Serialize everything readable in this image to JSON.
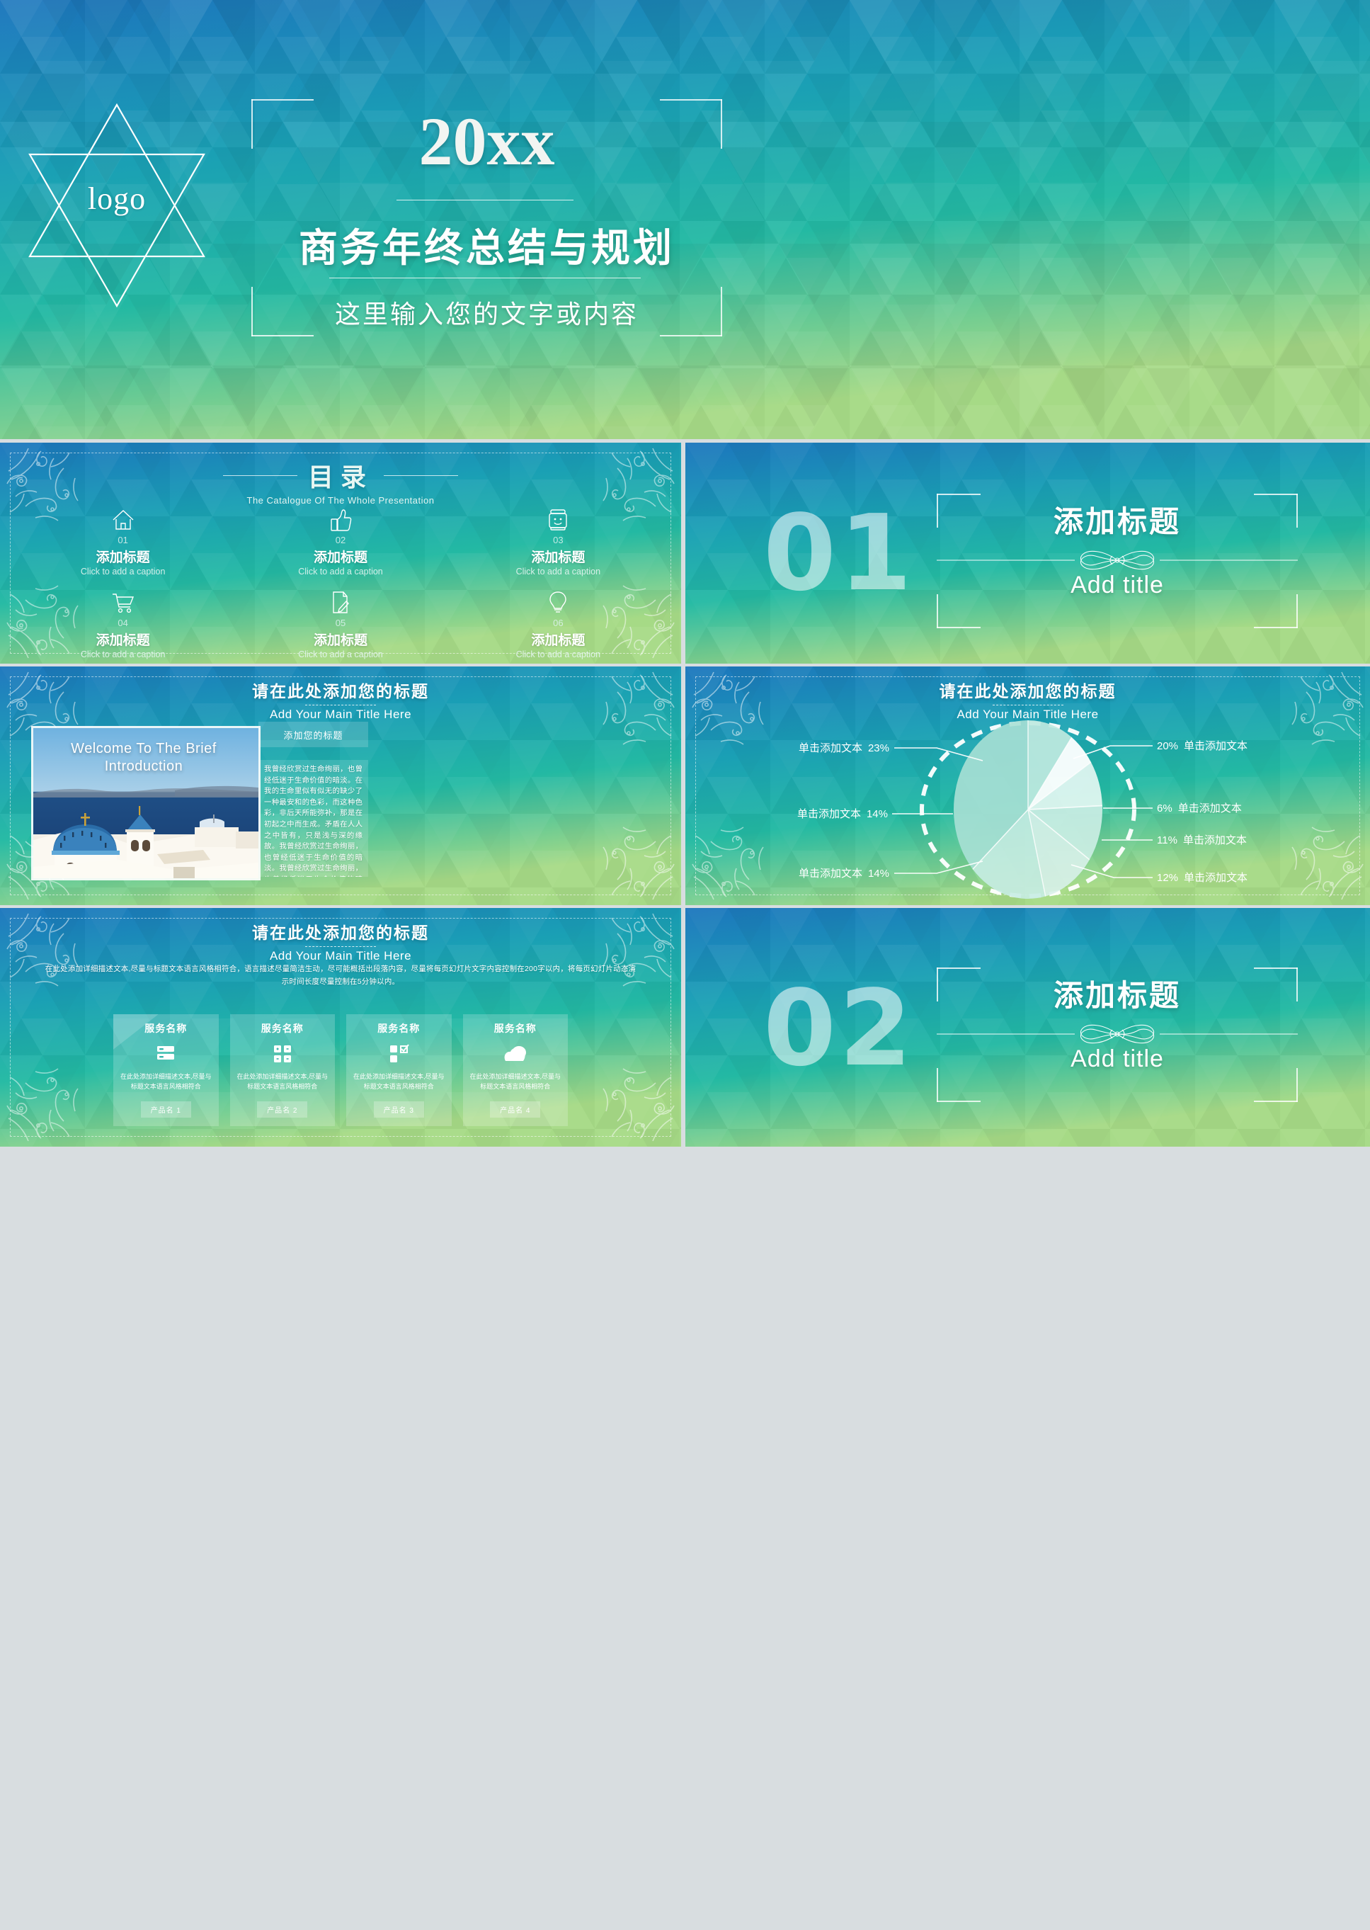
{
  "cover": {
    "logo_text": "logo",
    "year": "20xx",
    "title": "商务年终总结与规划",
    "subtitle": "这里输入您的文字或内容"
  },
  "catalogue": {
    "title": "目录",
    "subtitle": "The Catalogue Of The Whole Presentation",
    "items": [
      {
        "num": "01",
        "icon": "home-icon",
        "title": "添加标题",
        "caption": "Click to add a caption"
      },
      {
        "num": "02",
        "icon": "thumbs-up-icon",
        "title": "添加标题",
        "caption": "Click to add a caption"
      },
      {
        "num": "03",
        "icon": "robot-face-icon",
        "title": "添加标题",
        "caption": "Click to add a caption"
      },
      {
        "num": "04",
        "icon": "cart-icon",
        "title": "添加标题",
        "caption": "Click to add a caption"
      },
      {
        "num": "05",
        "icon": "document-edit-icon",
        "title": "添加标题",
        "caption": "Click to add a caption"
      },
      {
        "num": "06",
        "icon": "lightbulb-icon",
        "title": "添加标题",
        "caption": "Click to add a caption"
      }
    ]
  },
  "section1": {
    "number": "01",
    "title": "添加标题",
    "english": "Add title"
  },
  "section2": {
    "number": "02",
    "title": "添加标题",
    "english": "Add title"
  },
  "welcome": {
    "heading_cn": "请在此处添加您的标题",
    "heading_en": "Add Your Main Title Here",
    "image_caption": "Welcome To The Brief Introduction",
    "panel_label": "添加您的标题",
    "body": "我曾经欣赏过生命绚丽，也曾经低迷于生命价值的暗淡。在我的生命里似有似无的缺少了一种最安和的色彩，而这种色彩，非后天所能弥补，那是在初起之中而生成。矛盾在人人之中皆有，只是浅与深的缘故。我曾经欣赏过生命绚丽，也曾经低迷于生命价值的暗淡。我曾经欣赏过生命绚丽，也曾经低迷于生命价值的暗淡。在我的生命里似有似无的缺少了一种最安和的色彩，而这种色彩，非后天所能弥补，那是在初起之中而生成。"
  },
  "pie_slide": {
    "heading_cn": "请在此处添加您的标题",
    "heading_en": "Add Your Main Title Here"
  },
  "chart_data": {
    "type": "pie",
    "title": "请在此处添加您的标题",
    "subtitle": "Add Your Main Title Here",
    "legend_position": "left-and-right callouts",
    "labels": [
      "单击添加文本",
      "单击添加文本",
      "单击添加文本",
      "单击添加文本",
      "单击添加文本",
      "单击添加文本",
      "单击添加文本"
    ],
    "values": [
      20,
      6,
      11,
      12,
      14,
      14,
      23
    ],
    "value_strings": [
      "20%",
      "6%",
      "11%",
      "12%",
      "14%",
      "14%",
      "23%"
    ],
    "callouts_right": [
      {
        "value": "20%",
        "label": "单击添加文本"
      },
      {
        "value": "6%",
        "label": "单击添加文本"
      },
      {
        "value": "11%",
        "label": "单击添加文本"
      },
      {
        "value": "12%",
        "label": "单击添加文本"
      }
    ],
    "callouts_left": [
      {
        "label": "单击添加文本",
        "value": "23%"
      },
      {
        "label": "单击添加文本",
        "value": "14%"
      },
      {
        "label": "单击添加文本",
        "value": "14%"
      }
    ]
  },
  "services": {
    "heading_cn": "请在此处添加您的标题",
    "heading_en": "Add Your Main Title Here",
    "paragraph": "在此处添加详细描述文本,尽量与标题文本语言风格相符合，语言描述尽量简洁生动，尽可能概括出段落内容，尽量将每页幻灯片文字内容控制在200字以内，将每页幻灯片动态演示时间长度尽量控制在5分钟以内。",
    "cards": [
      {
        "name": "服务名称",
        "icon": "server-icon",
        "desc": "在此处添加详细描述文本,尽量与标题文本语言风格相符合",
        "button": "产品名 1"
      },
      {
        "name": "服务名称",
        "icon": "calculator-icon",
        "desc": "在此处添加详细描述文本,尽量与标题文本语言风格相符合",
        "button": "产品名 2"
      },
      {
        "name": "服务名称",
        "icon": "checklist-icon",
        "desc": "在此处添加详细描述文本,尽量与标题文本语言风格相符合",
        "button": "产品名 3"
      },
      {
        "name": "服务名称",
        "icon": "cloud-icon",
        "desc": "在此处添加详细描述文本,尽量与标题文本语言风格相符合",
        "button": "产品名 4"
      }
    ]
  },
  "colors": {
    "gradient_top": "#1f7fb8",
    "gradient_mid": "#20b3a8",
    "gradient_bottom": "#9ed88a",
    "text_white": "#ffffff"
  }
}
